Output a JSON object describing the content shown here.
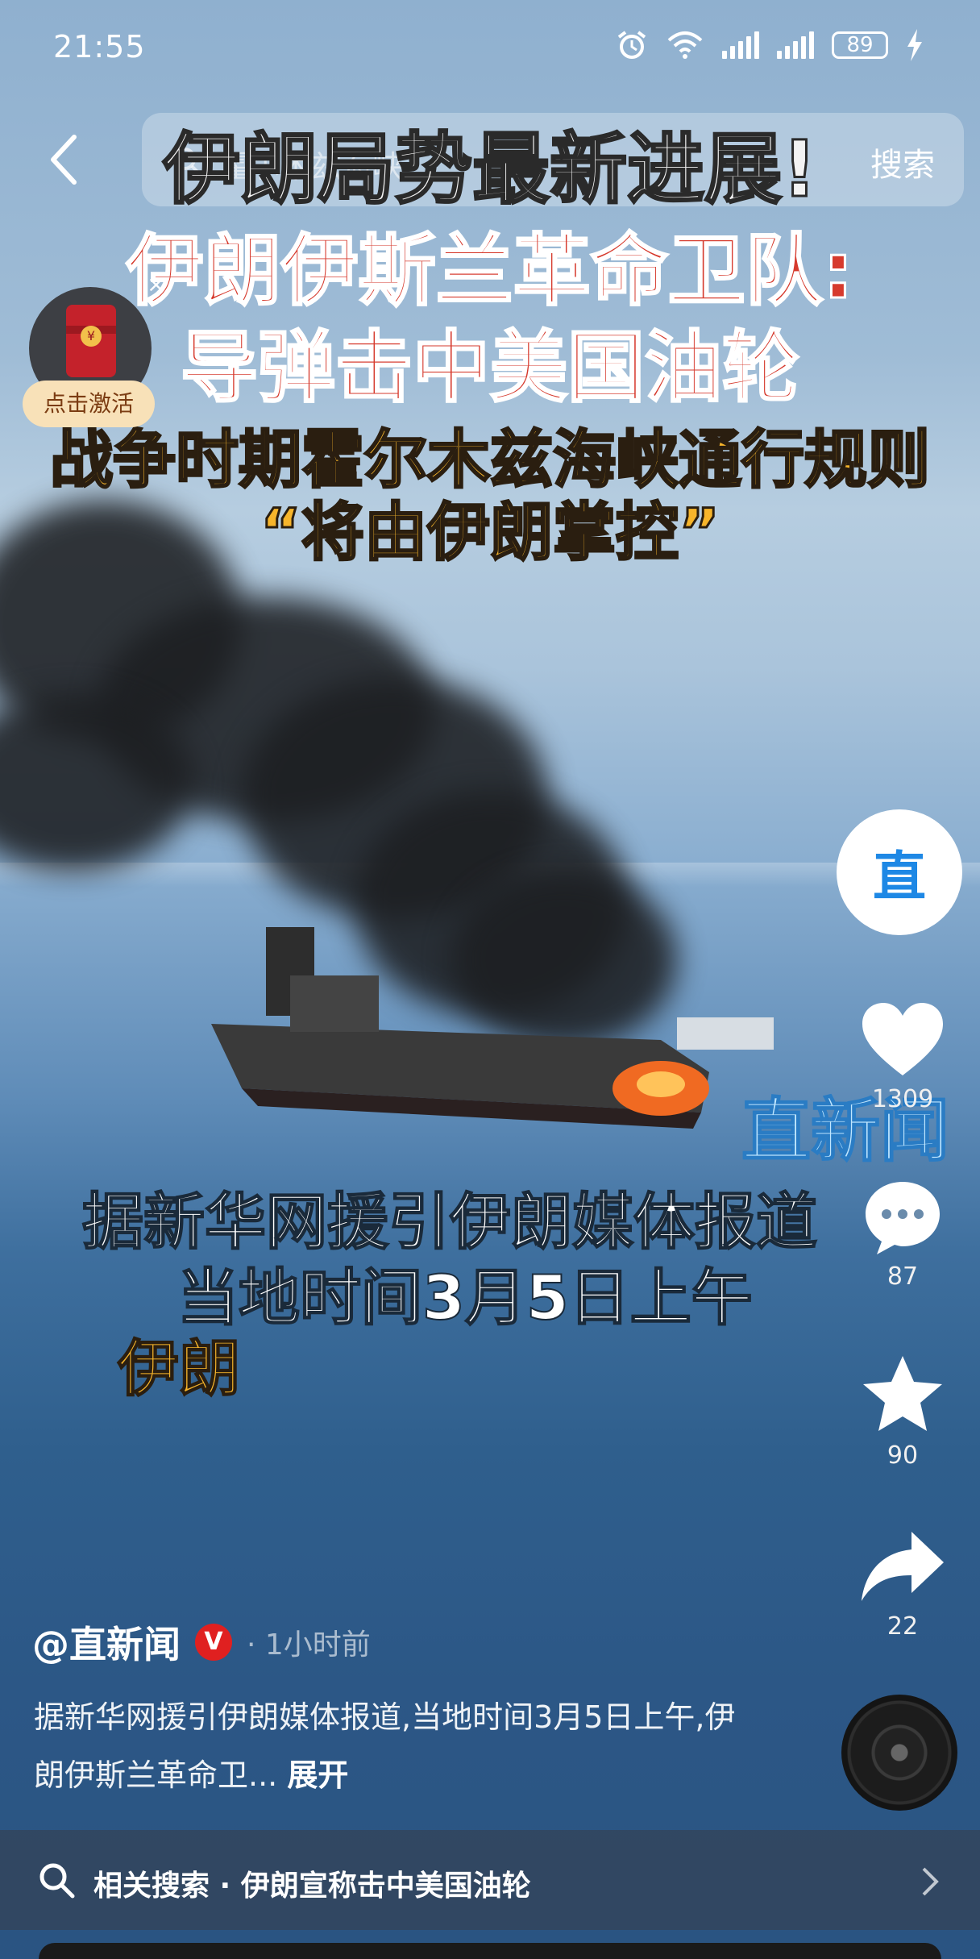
{
  "status_bar": {
    "time": "21:55",
    "battery": "89",
    "icons": [
      "alarm-icon",
      "wifi-icon",
      "signal-icon",
      "signal-icon",
      "battery-icon",
      "charging-icon"
    ]
  },
  "search": {
    "placeholder": "霍尔木兹海峡",
    "button": "搜索"
  },
  "headline": {
    "line1": "伊朗局势最新进展!",
    "line2": "伊朗伊斯兰革命卫队:",
    "line3": "导弹击中美国油轮",
    "line4": "战争时期霍尔木兹海峡通行规则",
    "line5": "“将由伊朗掌控”"
  },
  "red_packet": {
    "label": "点击激活",
    "coin": "¥",
    "close": "×"
  },
  "subtitles": {
    "line1": "据新华网援引伊朗媒体报道",
    "line2": "当地时间3月5日上午",
    "line3": "伊朗"
  },
  "watermark": "直新闻",
  "rail": {
    "avatar": "直",
    "likes": "1309",
    "comments": "87",
    "favorites": "90",
    "shares": "22"
  },
  "post": {
    "author": "@直新闻",
    "verified": "V",
    "time": "· 1小时前",
    "description": "据新华网援引伊朗媒体报道,当地时间3月5日上午,伊朗伊斯兰革命卫...",
    "expand": "展开"
  },
  "related": {
    "label": "相关搜索 · 伊朗宣称击中美国油轮"
  },
  "colors": {
    "accent_red": "#d63a2d",
    "accent_gold": "#f7b52b",
    "verified_red": "#e02020"
  }
}
